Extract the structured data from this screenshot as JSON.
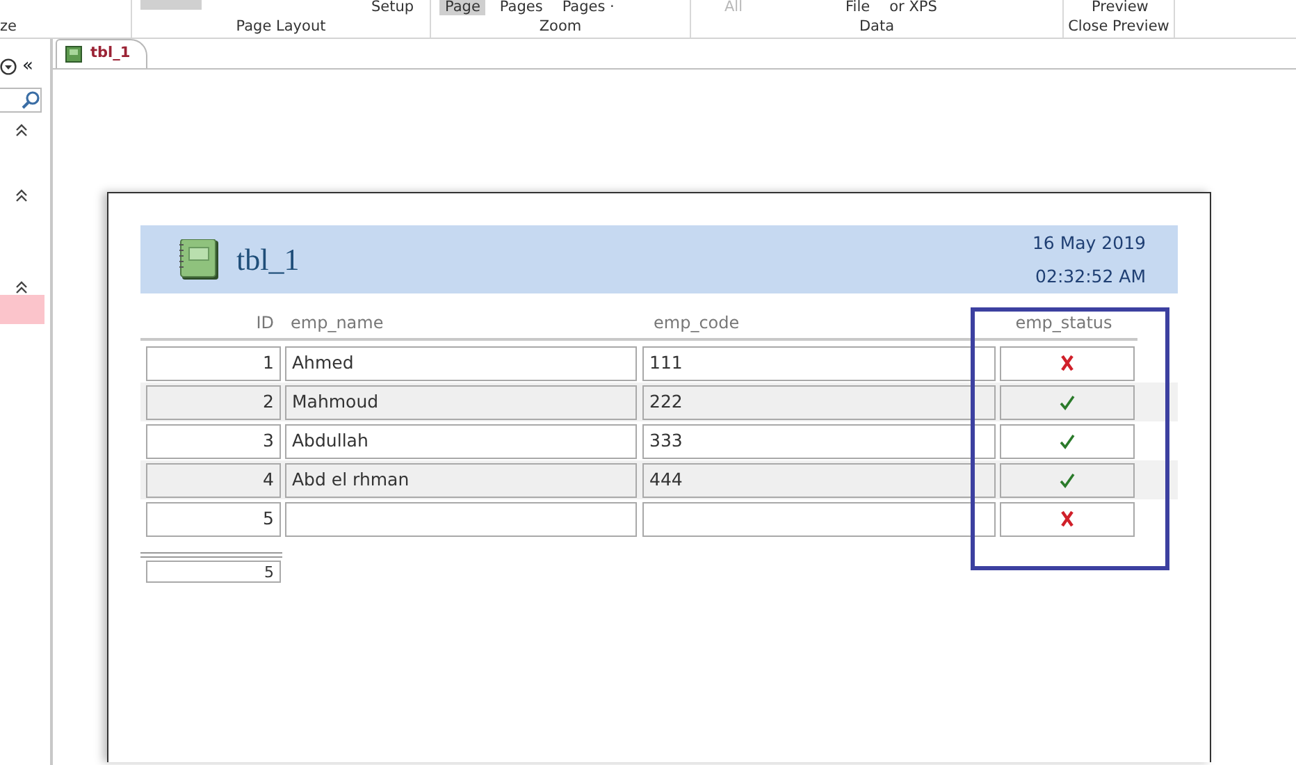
{
  "ribbon": {
    "groups": [
      {
        "label": "ze"
      },
      {
        "label": "Page Layout",
        "buttons": [
          {
            "label": "Setup",
            "selected": false,
            "disabled": false
          }
        ]
      },
      {
        "label": "Zoom",
        "buttons": [
          {
            "label": "Page",
            "selected": true,
            "disabled": false
          },
          {
            "label": "Pages",
            "selected": false,
            "disabled": false
          },
          {
            "label": "Pages ·",
            "selected": false,
            "disabled": false
          }
        ]
      },
      {
        "label": "Data",
        "buttons": [
          {
            "label": "All",
            "selected": false,
            "disabled": true
          },
          {
            "label": "File",
            "selected": false,
            "disabled": false
          },
          {
            "label": "or XPS",
            "selected": false,
            "disabled": false
          }
        ]
      },
      {
        "label": "Close Preview",
        "buttons": [
          {
            "label": "Preview",
            "selected": false,
            "disabled": false
          }
        ]
      }
    ]
  },
  "nav_pane": {
    "collapse": "«",
    "items": [
      {
        "selected": true
      }
    ]
  },
  "tabs": [
    {
      "label": "tbl_1",
      "selected": true
    }
  ],
  "report": {
    "title": "tbl_1",
    "date": "16 May 2019",
    "time": "02:32:52 AM",
    "columns": [
      "ID",
      "emp_name",
      "emp_code",
      "emp_status"
    ],
    "rows": [
      {
        "id": "1",
        "emp_name": "Ahmed",
        "emp_code": "111",
        "emp_status": false
      },
      {
        "id": "2",
        "emp_name": "Mahmoud",
        "emp_code": "222",
        "emp_status": true
      },
      {
        "id": "3",
        "emp_name": "Abdullah",
        "emp_code": "333",
        "emp_status": true
      },
      {
        "id": "4",
        "emp_name": "Abd el rhman",
        "emp_code": "444",
        "emp_status": true
      },
      {
        "id": "5",
        "emp_status": false
      }
    ],
    "total": "5"
  }
}
